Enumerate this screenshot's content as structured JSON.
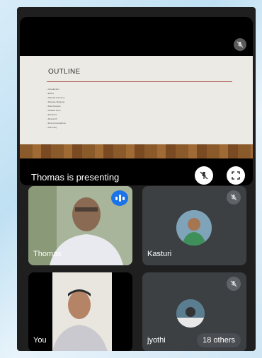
{
  "presentation": {
    "slide_title": "OUTLINE",
    "slide_items": [
      "Introduction",
      "Ethics",
      "Special Concerns",
      "Disease Mapping",
      "Risk Analysis",
      "Studies done",
      "Evidence",
      "Research",
      "Recommendations",
      "Summary"
    ],
    "presenter_label": "Thomas is presenting",
    "icons": {
      "mic_off": "mic-off-icon",
      "unpin": "pin-off-icon",
      "fullscreen": "fullscreen-icon"
    }
  },
  "participants": [
    {
      "name": "Thomas",
      "speaking": true
    },
    {
      "name": "Kasturi",
      "muted": true
    },
    {
      "name": "You"
    },
    {
      "name": "jyothi",
      "muted": true
    }
  ],
  "others": {
    "label": "18 others"
  },
  "colors": {
    "accent": "#1a73e8",
    "tile_bg": "#3c4043",
    "window_bg": "#1f1f1f"
  }
}
